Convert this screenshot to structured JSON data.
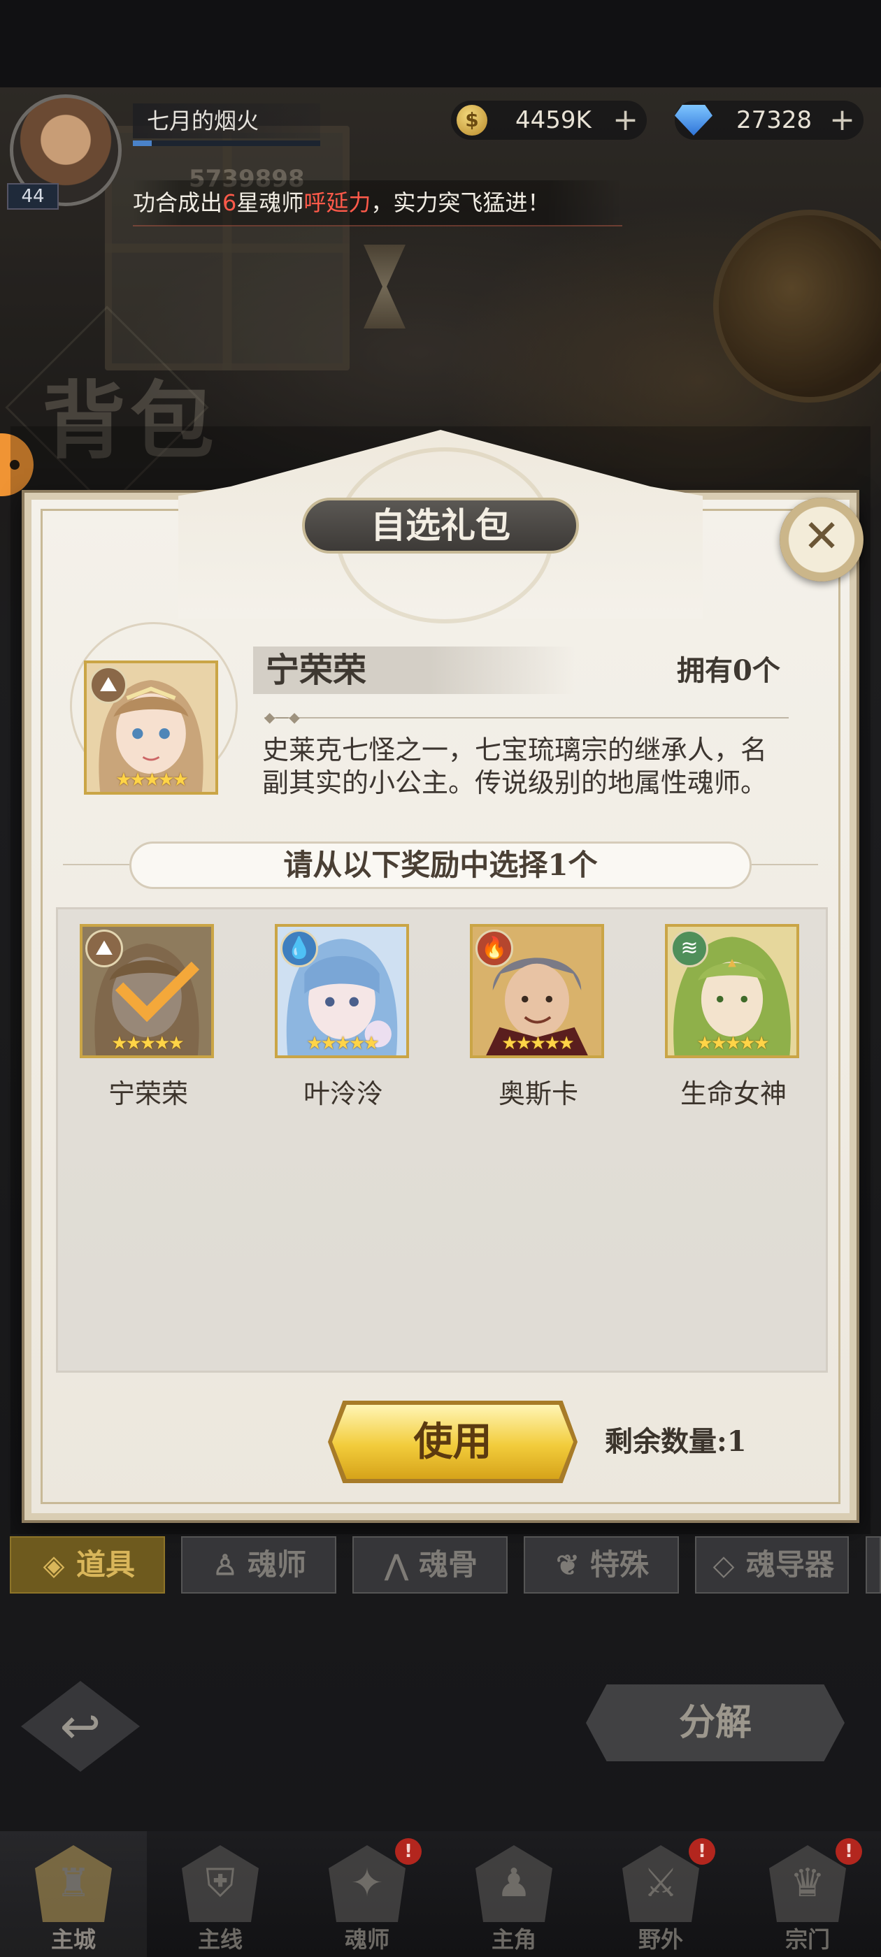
{
  "player": {
    "name": "七月的烟火",
    "level": "44",
    "power": "5739898",
    "exp_fraction": 0.1
  },
  "currencies": {
    "coins": "4459K",
    "coin_symbol": "$",
    "gems": "27328",
    "plus": "+"
  },
  "broadcast": {
    "part1": "功合成出",
    "star_count": "6",
    "part2": "星魂师",
    "hero": "呼延力",
    "part3": "，实力突飞猛进！"
  },
  "page": {
    "heading": "背包"
  },
  "modal": {
    "title": "自选礼包",
    "close_symbol": "✕",
    "featured": {
      "name": "宁荣荣",
      "owned": "拥有0个",
      "description": "史莱克七怪之一，七宝琉璃宗的继承人，名副其实的小公主。传说级别的地属性魂师。",
      "element_icon": "mountain-icon",
      "stars": "★★★★★"
    },
    "choose_prompt": "请从以下奖励中选择1个",
    "rewards": [
      {
        "name": "宁荣荣",
        "element_icon": "mountain-icon",
        "stars": "★★★★★",
        "selected": true
      },
      {
        "name": "叶泠泠",
        "element_icon": "water-drop-icon",
        "stars": "★★★★★",
        "selected": false
      },
      {
        "name": "奥斯卡",
        "element_icon": "fire-icon",
        "stars": "★★★★★",
        "selected": false
      },
      {
        "name": "生命女神",
        "element_icon": "wind-icon",
        "stars": "★★★★★",
        "selected": false
      }
    ],
    "use_label": "使用",
    "remaining_label": "剩余数量:1"
  },
  "category_tabs": [
    {
      "label": "道具",
      "icon": "item-icon",
      "active": true
    },
    {
      "label": "魂师",
      "icon": "soul-master-icon",
      "active": false
    },
    {
      "label": "魂骨",
      "icon": "soul-bone-icon",
      "active": false
    },
    {
      "label": "特殊",
      "icon": "special-icon",
      "active": false
    },
    {
      "label": "魂导器",
      "icon": "soul-device-icon",
      "active": false
    }
  ],
  "actions": {
    "decompose_label": "分解",
    "back_icon": "back-arrow-icon"
  },
  "bottom_nav": [
    {
      "label": "主城",
      "active": true,
      "badge": ""
    },
    {
      "label": "主线",
      "active": false,
      "badge": ""
    },
    {
      "label": "魂师",
      "active": false,
      "badge": "!"
    },
    {
      "label": "主角",
      "active": false,
      "badge": ""
    },
    {
      "label": "野外",
      "active": false,
      "badge": "!"
    },
    {
      "label": "宗门",
      "active": false,
      "badge": "!"
    }
  ],
  "colors": {
    "accent_gold": "#f2cc3b",
    "highlight_red": "#ff5a4a",
    "star_yellow": "#ffd447",
    "check_orange": "#f4a83a"
  }
}
